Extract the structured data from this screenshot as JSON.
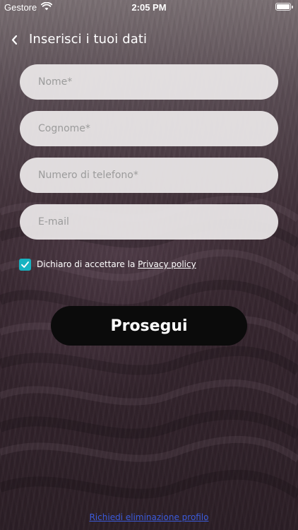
{
  "status_bar": {
    "carrier": "Gestore",
    "time": "2:05 PM",
    "battery_level": 1.0
  },
  "header": {
    "title": "Inserisci i tuoi dati",
    "back_icon": "chevron-left-icon"
  },
  "form": {
    "nome": {
      "placeholder": "Nome*",
      "value": ""
    },
    "cognome": {
      "placeholder": "Cognome*",
      "value": ""
    },
    "telefono": {
      "placeholder": "Numero di telefono*",
      "value": ""
    },
    "email": {
      "placeholder": "E-mail",
      "value": ""
    }
  },
  "privacy": {
    "checked": true,
    "text": "Dichiaro di accettare la ",
    "link_label": "Privacy policy"
  },
  "continue_label": "Prosegui",
  "delete_link_label": "Richiedi eliminazione profilo",
  "colors": {
    "accent": "#17b3c1",
    "button_bg": "#0b0b0b",
    "field_bg": "#ece8e9",
    "link": "#3b5bdb"
  }
}
